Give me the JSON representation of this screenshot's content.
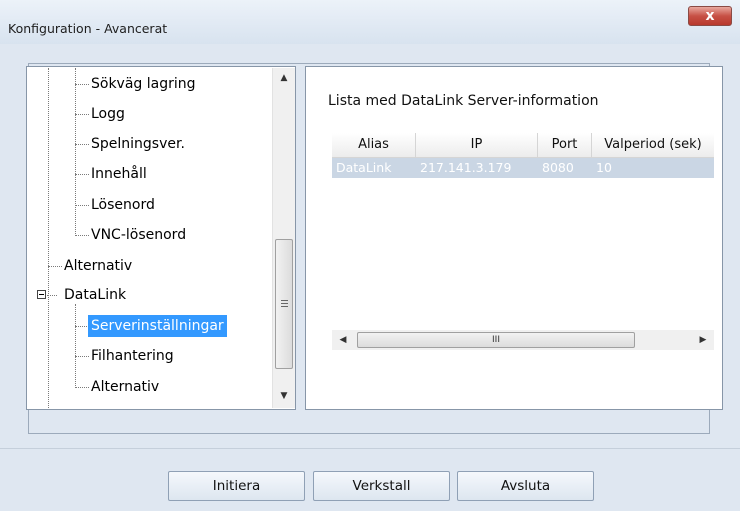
{
  "window": {
    "title": "Konfiguration - Avancerat",
    "close_glyph": "x"
  },
  "tree": {
    "items": [
      {
        "label": "Sökväg lagring"
      },
      {
        "label": "Logg"
      },
      {
        "label": "Spelningsver."
      },
      {
        "label": "Innehåll"
      },
      {
        "label": "Lösenord"
      },
      {
        "label": "VNC-lösenord"
      },
      {
        "label": "Alternativ"
      },
      {
        "label": "DataLink"
      },
      {
        "label": "Serverinställningar"
      },
      {
        "label": "Filhantering"
      },
      {
        "label": "Alternativ"
      }
    ],
    "selected": "Serverinställningar",
    "scroll_up": "▲",
    "scroll_down": "▼"
  },
  "server_list": {
    "title": "Lista med DataLink Server-information",
    "columns": [
      "Alias",
      "IP",
      "Port",
      "Valperiod (sek)"
    ],
    "rows": [
      [
        "DataLink",
        "217.141.3.179",
        "8080",
        "10"
      ]
    ],
    "scroll_left": "◀",
    "scroll_right": "▶",
    "thumb_grip": "III"
  },
  "buttons": {
    "initiera": "Initiera",
    "verkstall": "Verkstall",
    "avsluta": "Avsluta"
  },
  "colors": {
    "selection": "#3399ff",
    "row_highlight": "#cad6e4",
    "window_bg": "#dfe7f1"
  }
}
